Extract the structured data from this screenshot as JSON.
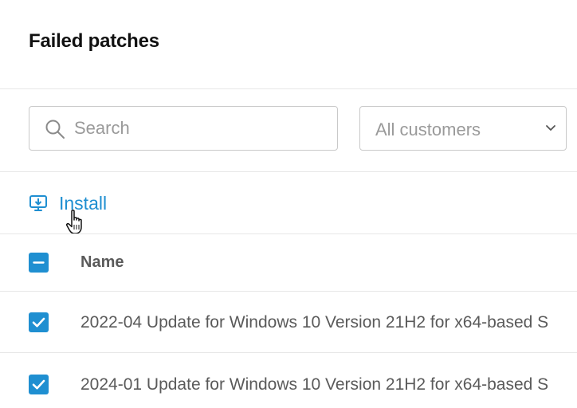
{
  "page": {
    "title": "Failed patches"
  },
  "filters": {
    "search_placeholder": "Search",
    "customer_select_value": "All customers"
  },
  "actions": {
    "install_label": "Install"
  },
  "table": {
    "columns": [
      "Name"
    ],
    "rows": [
      {
        "name": "2022-04 Update for Windows 10 Version 21H2 for x64-based S",
        "checked": true
      },
      {
        "name": "2024-01 Update for Windows 10 Version 21H2 for x64-based S",
        "checked": true
      }
    ]
  },
  "colors": {
    "accent": "#1f8fd1",
    "border": "#c9c9c9",
    "divider": "#e7e7e7"
  }
}
